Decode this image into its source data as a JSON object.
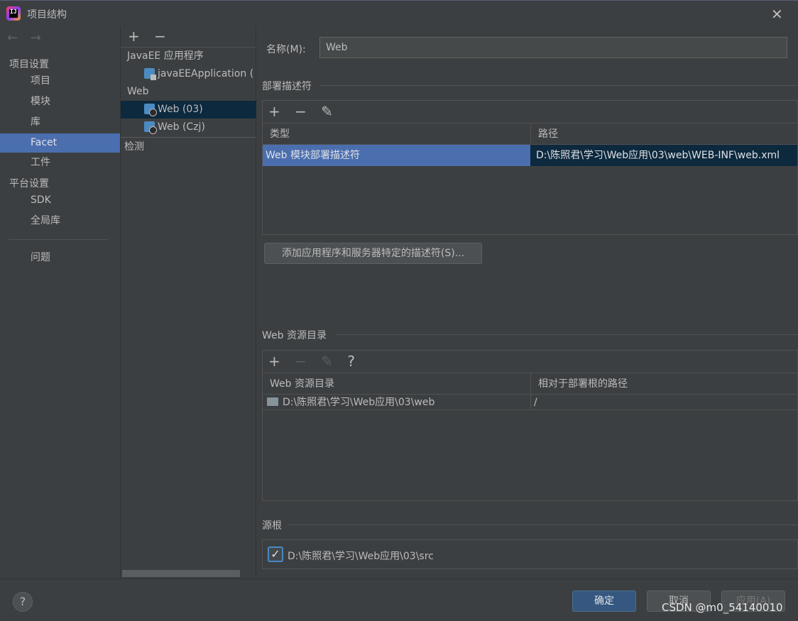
{
  "window": {
    "title": "项目结构"
  },
  "nav": {
    "back": "←",
    "forward": "→",
    "section_project": "项目设置",
    "project_items": [
      "项目",
      "模块",
      "库",
      "Facet",
      "工件"
    ],
    "section_platform": "平台设置",
    "platform_items": [
      "SDK",
      "全局库"
    ],
    "problems": "问题"
  },
  "tree": {
    "add": "+",
    "remove": "−",
    "group_javaee": "JavaEE 应用程序",
    "javaee_app": "javaEEApplication (",
    "group_web": "Web",
    "web_03": "Web (03)",
    "web_czj": "Web (Czj)",
    "inspection": "检测"
  },
  "main": {
    "name_label": "名称(M):",
    "name_value": "Web",
    "deploy_title": "部署描述符",
    "deploy_toolbar": {
      "add": "+",
      "remove": "−",
      "edit": "✎"
    },
    "deploy_columns": [
      "类型",
      "路径"
    ],
    "deploy_rows": [
      {
        "type": "Web 模块部署描述符",
        "path": "D:\\陈照君\\学习\\Web应用\\03\\web\\WEB-INF\\web.xml"
      }
    ],
    "add_descriptor_button": "添加应用程序和服务器特定的描述符(S)...",
    "resource_title": "Web 资源目录",
    "resource_toolbar": {
      "add": "+",
      "remove": "−",
      "edit": "✎",
      "help": "?"
    },
    "resource_columns": [
      "Web 资源目录",
      "相对于部署根的路径"
    ],
    "resource_rows": [
      {
        "dir": "D:\\陈照君\\学习\\Web应用\\03\\web",
        "rel": "/"
      }
    ],
    "source_title": "源根",
    "source_checkbox": "✓",
    "source_path": "D:\\陈照君\\学习\\Web应用\\03\\src"
  },
  "footer": {
    "help": "?",
    "ok": "确定",
    "cancel": "取消",
    "apply": "应用(A)",
    "watermark": "CSDN @m0_54140010"
  },
  "colors": {
    "selection": "#4b6eaf",
    "tree_selection": "#0d293e",
    "primary_button": "#365880"
  }
}
